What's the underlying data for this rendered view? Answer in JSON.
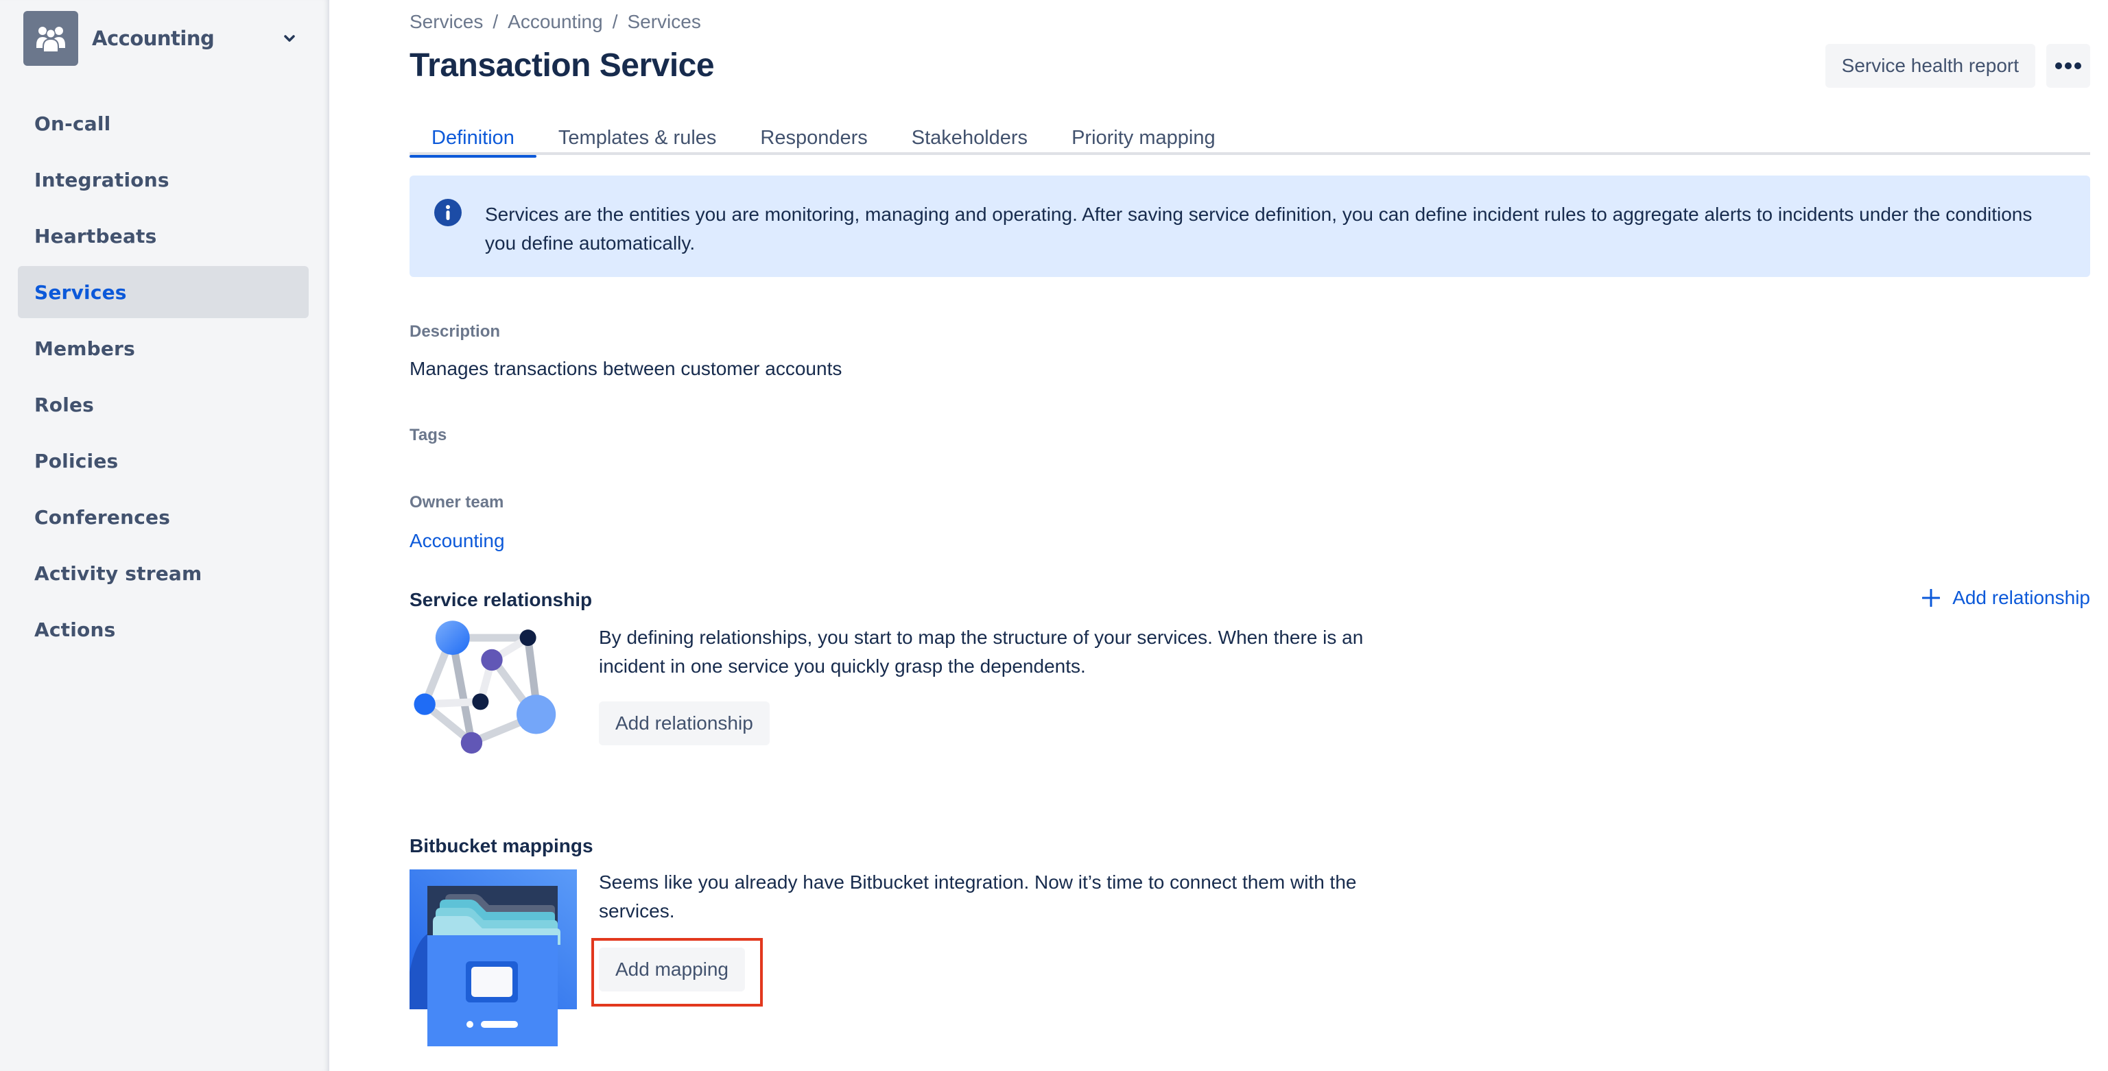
{
  "sidebar": {
    "team_name": "Accounting",
    "team_icon": "people-group-icon",
    "items": [
      {
        "label": "On-call",
        "active": false
      },
      {
        "label": "Integrations",
        "active": false
      },
      {
        "label": "Heartbeats",
        "active": false
      },
      {
        "label": "Services",
        "active": true
      },
      {
        "label": "Members",
        "active": false
      },
      {
        "label": "Roles",
        "active": false
      },
      {
        "label": "Policies",
        "active": false
      },
      {
        "label": "Conferences",
        "active": false
      },
      {
        "label": "Activity stream",
        "active": false
      },
      {
        "label": "Actions",
        "active": false
      }
    ]
  },
  "breadcrumb": [
    "Services",
    "Accounting",
    "Services"
  ],
  "breadcrumb_separator": "/",
  "header": {
    "title": "Transaction Service",
    "health_report_label": "Service health report",
    "more_icon": "ellipsis-icon"
  },
  "tabs": [
    {
      "label": "Definition",
      "active": true
    },
    {
      "label": "Templates & rules",
      "active": false
    },
    {
      "label": "Responders",
      "active": false
    },
    {
      "label": "Stakeholders",
      "active": false
    },
    {
      "label": "Priority mapping",
      "active": false
    }
  ],
  "info_banner": {
    "icon": "info-icon",
    "text": "Services are the entities you are monitoring, managing and operating. After saving service definition, you can define incident rules to aggregate alerts to incidents under the conditions you define automatically."
  },
  "definition": {
    "description_label": "Description",
    "description_value": "Manages transactions between customer accounts",
    "tags_label": "Tags",
    "owner_team_label": "Owner team",
    "owner_team_value": "Accounting"
  },
  "service_relationship": {
    "title": "Service relationship",
    "add_link_label": "Add relationship",
    "text": "By defining relationships, you start to map the structure of your services. When there is an incident in one service you quickly grasp the dependents.",
    "button_label": "Add relationship"
  },
  "bitbucket_mappings": {
    "title": "Bitbucket mappings",
    "text": "Seems like you already have Bitbucket integration. Now it’s time to connect them with the services.",
    "button_label": "Add mapping"
  },
  "colors": {
    "accent": "#0c59d9",
    "sidebar_bg": "#f4f5f7",
    "info_bg": "#deebff",
    "highlight": "#e2381e"
  }
}
